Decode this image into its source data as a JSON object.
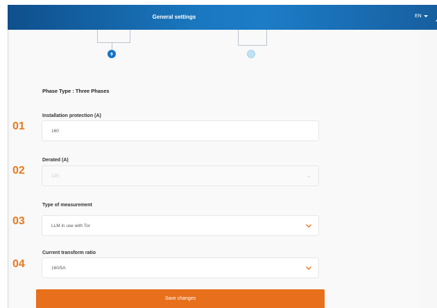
{
  "header": {
    "title": "General settings",
    "lang": "EN"
  },
  "icons": {
    "user": "user-icon",
    "flash": "lightning-icon",
    "chevron": "chevron-down-icon",
    "language_caret": "caret-down-icon"
  },
  "colors": {
    "header_start": "#0f4f8c",
    "header_mid": "#1c7cc7",
    "accent_orange": "#e8701c",
    "step_active": "#1673c4",
    "step_inactive": "#bfe2f3"
  },
  "form": {
    "phase_type": "Phase Type : Three Phases",
    "fields": [
      {
        "number": "01",
        "label": "Installation protection (A)",
        "value": "160",
        "type": "input"
      },
      {
        "number": "02",
        "label": "Derated (A)",
        "value": "125",
        "type": "select",
        "disabled": true
      },
      {
        "number": "03",
        "label": "Type of measurement",
        "value": "LLM in use with Tor",
        "type": "select"
      },
      {
        "number": "04",
        "label": "Current transform ratio",
        "value": "160/5A",
        "type": "select"
      }
    ],
    "save_label": "Save changes"
  }
}
